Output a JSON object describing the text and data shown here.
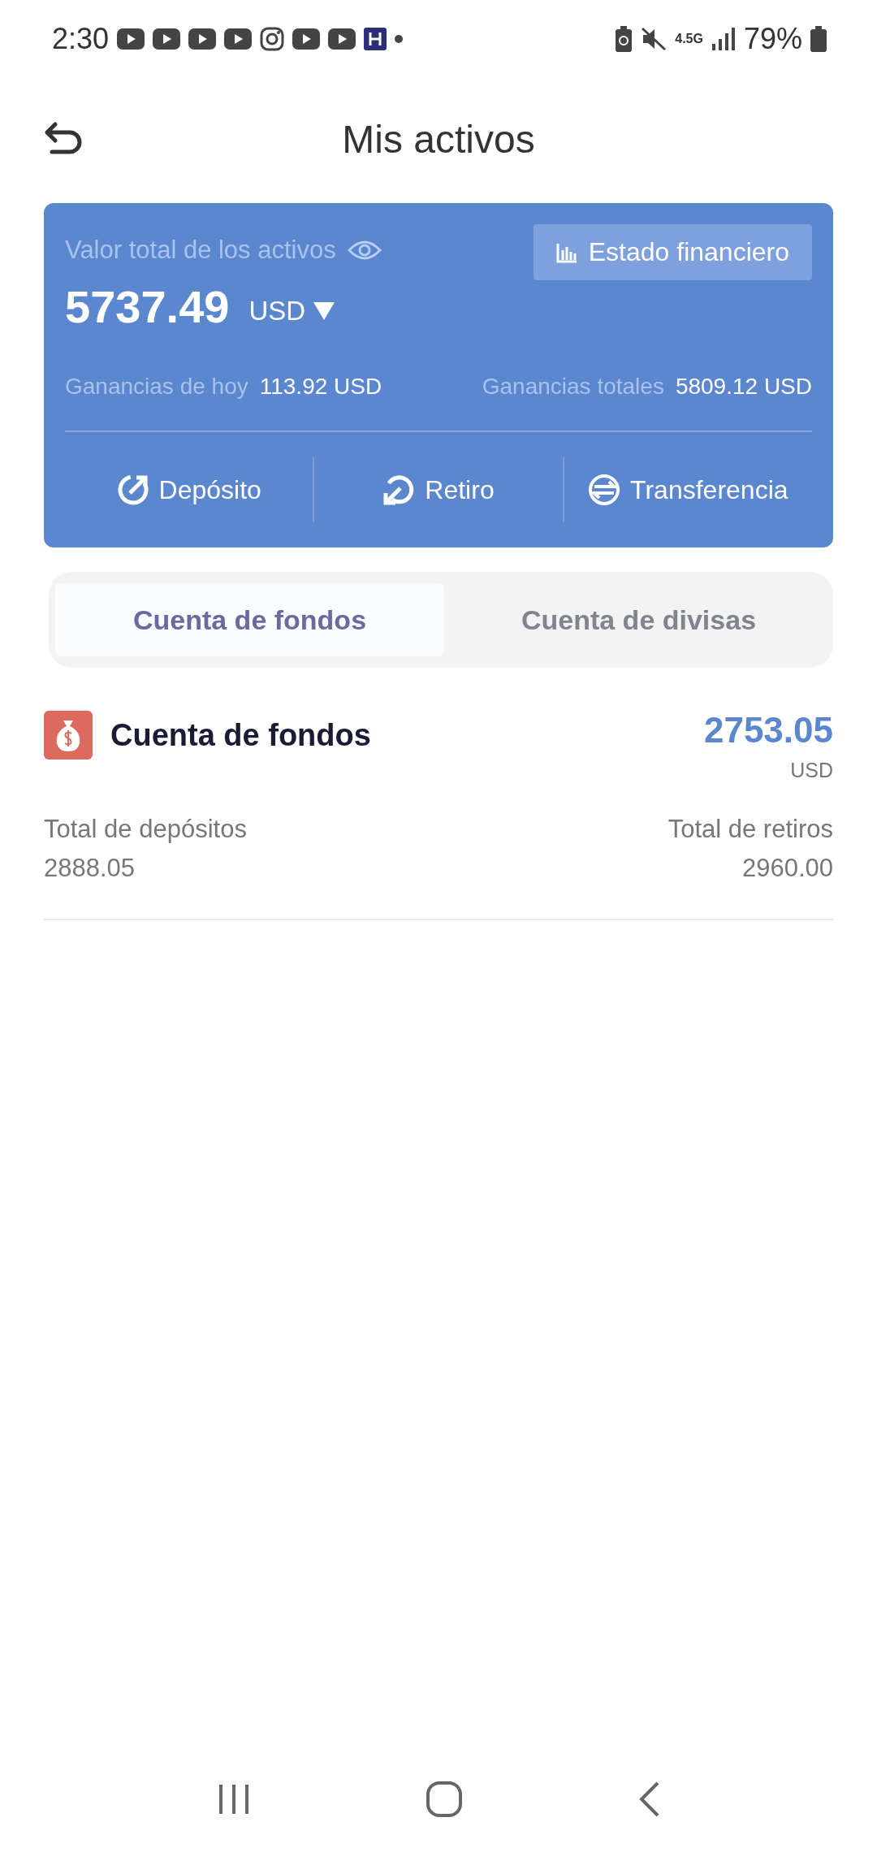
{
  "status_bar": {
    "time": "2:30",
    "battery": "79%",
    "network": "4.5G"
  },
  "header": {
    "title": "Mis activos"
  },
  "summary": {
    "label": "Valor total de los activos",
    "statement_button": "Estado financiero",
    "total": "5737.49",
    "currency": "USD",
    "stats": [
      {
        "label": "Ganancias de hoy",
        "value": "113.92 USD"
      },
      {
        "label": "Ganancias totales",
        "value": "5809.12 USD"
      }
    ],
    "actions": [
      {
        "kind": "deposit",
        "label": "Depósito"
      },
      {
        "kind": "withdraw",
        "label": "Retiro"
      },
      {
        "kind": "transfer",
        "label": "Transferencia"
      }
    ]
  },
  "tabs": [
    {
      "label": "Cuenta de fondos",
      "selected": true
    },
    {
      "label": "Cuenta de divisas",
      "selected": false
    }
  ],
  "account": {
    "title": "Cuenta de fondos",
    "balance": "2753.05",
    "currency": "USD",
    "totals": [
      {
        "label": "Total de depósitos",
        "value": "2888.05"
      },
      {
        "label": "Total de retiros",
        "value": "2960.00"
      }
    ]
  }
}
